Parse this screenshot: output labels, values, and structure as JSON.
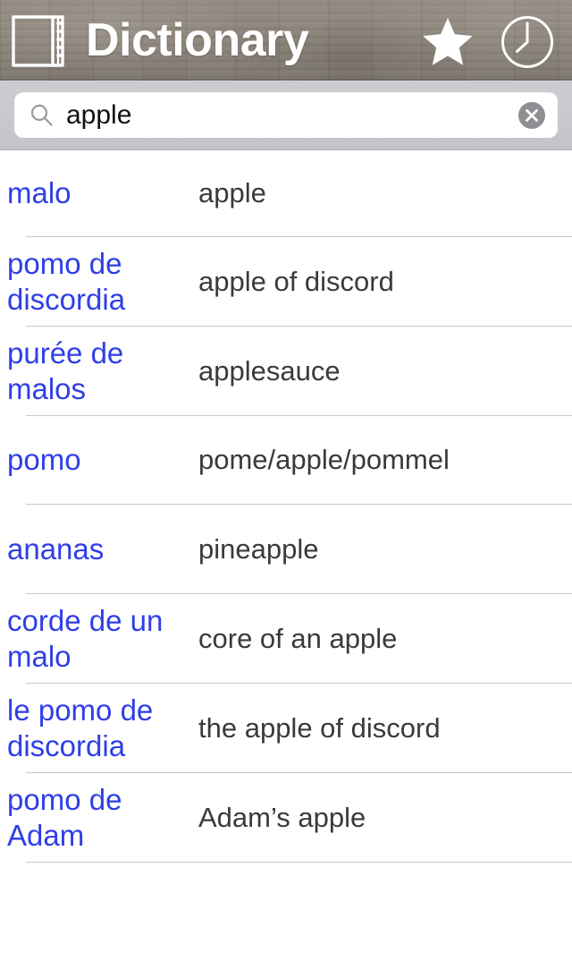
{
  "header": {
    "title": "Dictionary",
    "book_icon": "book-icon",
    "star_icon": "star-icon",
    "clock_icon": "clock-icon",
    "background_color": "#8a8279",
    "title_color": "#ffffff"
  },
  "search": {
    "value": "apple",
    "placeholder": "Search",
    "search_icon": "search-icon",
    "clear_icon": "clear-icon",
    "bar_color": "#c9c9cd",
    "field_color": "#ffffff",
    "clear_button_color": "#8e8e93"
  },
  "results": {
    "term_color": "#2f3fe6",
    "definition_color": "#3a3a3a",
    "separator_color": "#c8c8cc",
    "columns": [
      "term",
      "definition"
    ],
    "rows": [
      {
        "term": "malo",
        "definition": "apple"
      },
      {
        "term": "pomo de discordia",
        "definition": "apple of discord"
      },
      {
        "term": "purée de malos",
        "definition": "applesauce"
      },
      {
        "term": "pomo",
        "definition": "pome/apple/pommel"
      },
      {
        "term": "ananas",
        "definition": "pineapple"
      },
      {
        "term": "corde de un malo",
        "definition": "core of an apple"
      },
      {
        "term": "le pomo de discordia",
        "definition": "the apple of discord"
      },
      {
        "term": "pomo de Adam",
        "definition": "Adam’s apple"
      }
    ]
  }
}
